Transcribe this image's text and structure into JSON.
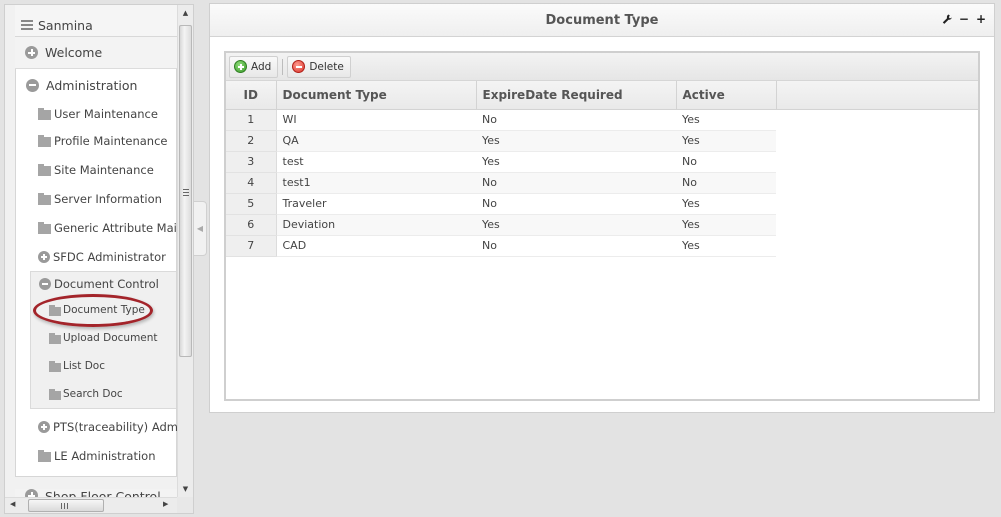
{
  "sidebar": {
    "root_label": "Sanmina",
    "sections": [
      {
        "label": "Welcome",
        "state": "collapsed"
      },
      {
        "label": "Administration",
        "state": "expanded"
      }
    ],
    "admin_items": [
      {
        "label": "User Maintenance",
        "icon": "folder-icon"
      },
      {
        "label": "Profile Maintenance",
        "icon": "folder-icon"
      },
      {
        "label": "Site Maintenance",
        "icon": "folder-icon"
      },
      {
        "label": "Server Information",
        "icon": "folder-icon"
      },
      {
        "label": "Generic Attribute Maintenance",
        "display": "Generic Attribute Mair",
        "icon": "folder-icon"
      },
      {
        "label": "SFDC Administrator",
        "icon": "plus-circle-icon"
      }
    ],
    "document_control": {
      "label": "Document Control",
      "items": [
        {
          "label": "Document Type",
          "selected": true
        },
        {
          "label": "Upload Document"
        },
        {
          "label": "List Doc"
        },
        {
          "label": "Search Doc"
        }
      ]
    },
    "admin_items_after": [
      {
        "label": "PTS(traceability) Administration",
        "display": "PTS(traceability) Admir",
        "icon": "plus-circle-icon"
      },
      {
        "label": "LE Administration",
        "icon": "folder-icon"
      }
    ],
    "next_section": {
      "label": "Shop Floor Control"
    }
  },
  "panel": {
    "title": "Document Type",
    "tools": {
      "settings": "wrench-icon",
      "minimize": "−",
      "maximize": "+"
    }
  },
  "grid": {
    "toolbar": {
      "add_label": "Add",
      "delete_label": "Delete"
    },
    "columns": [
      "ID",
      "Document Type",
      "ExpireDate Required",
      "Active"
    ],
    "rows": [
      {
        "id": "1",
        "type": "WI",
        "expire": "No",
        "active": "Yes"
      },
      {
        "id": "2",
        "type": "QA",
        "expire": "Yes",
        "active": "Yes"
      },
      {
        "id": "3",
        "type": "test",
        "expire": "Yes",
        "active": "No"
      },
      {
        "id": "4",
        "type": "test1",
        "expire": "No",
        "active": "No"
      },
      {
        "id": "5",
        "type": "Traveler",
        "expire": "No",
        "active": "Yes"
      },
      {
        "id": "6",
        "type": "Deviation",
        "expire": "Yes",
        "active": "Yes"
      },
      {
        "id": "7",
        "type": "CAD",
        "expire": "No",
        "active": "Yes"
      }
    ]
  },
  "colors": {
    "highlight_ring": "#a3242a",
    "add_icon": "#3a9a2a",
    "delete_icon": "#d9322a"
  }
}
